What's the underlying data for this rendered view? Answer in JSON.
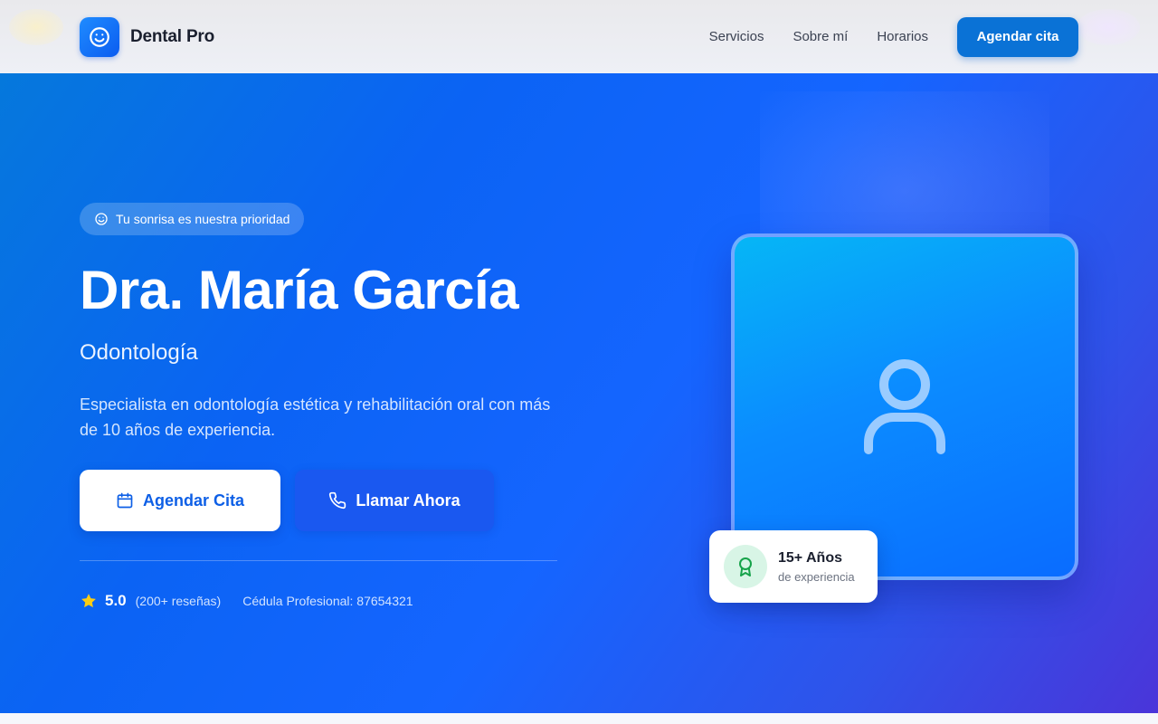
{
  "header": {
    "brand_name": "Dental Pro",
    "brand_icon": "smile-icon",
    "nav": [
      {
        "label": "Servicios"
      },
      {
        "label": "Sobre mí"
      },
      {
        "label": "Horarios"
      }
    ],
    "cta_label": "Agendar cita"
  },
  "hero": {
    "badge_icon": "smile-icon",
    "badge_text": "Tu sonrisa es nuestra prioridad",
    "title": "Dra. María García",
    "subtitle": "Odontología",
    "description": "Especialista en odontología estética y rehabilitación oral con más de 10 años de experiencia.",
    "primary_button": {
      "label": "Agendar Cita",
      "icon": "calendar-icon"
    },
    "secondary_button": {
      "label": "Llamar Ahora",
      "icon": "phone-icon"
    },
    "rating": {
      "value": "5.0",
      "reviews": "(200+ reseñas)",
      "icon": "star-icon"
    },
    "license": "Cédula Profesional: 87654321",
    "photo_icon": "user-icon",
    "experience": {
      "title": "15+ Años",
      "subtitle": "de experiencia",
      "icon": "award-icon"
    }
  },
  "colors": {
    "accent": "#0a72d6",
    "hero_start": "#0578dc",
    "hero_end": "#4a35d9",
    "star": "#facc15",
    "award": "#16a34a"
  }
}
